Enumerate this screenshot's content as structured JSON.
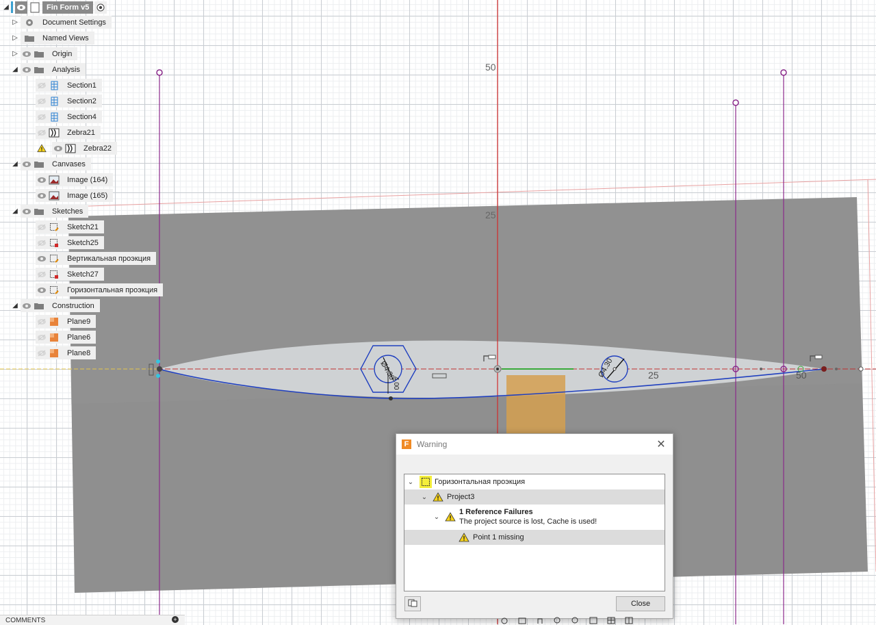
{
  "browser": {
    "root": "Fin  Form v5",
    "items": [
      {
        "label": "Document Settings"
      },
      {
        "label": "Named Views"
      },
      {
        "label": "Origin"
      },
      {
        "label": "Analysis"
      },
      {
        "label": "Section1"
      },
      {
        "label": "Section2"
      },
      {
        "label": "Section4"
      },
      {
        "label": "Zebra21"
      },
      {
        "label": "Zebra22"
      },
      {
        "label": "Canvases"
      },
      {
        "label": "Image (164)"
      },
      {
        "label": "Image (165)"
      },
      {
        "label": "Sketches"
      },
      {
        "label": "Sketch21"
      },
      {
        "label": "Sketch25"
      },
      {
        "label": "Вертикальная проэкция"
      },
      {
        "label": "Sketch27"
      },
      {
        "label": "Горизонтальная проэкция"
      },
      {
        "label": "Construction"
      },
      {
        "label": "Plane9"
      },
      {
        "label": "Plane6"
      },
      {
        "label": "Plane8"
      }
    ]
  },
  "canvas": {
    "dims": {
      "v50": "50",
      "v25": "25",
      "h25": "25",
      "h50": "50",
      "d1": "Ø4.30",
      "d2": "4.00",
      "d3": "Ø4.30"
    },
    "colors": {
      "sketch_line": "#1f3fbf",
      "axis_red": "#d22a2a",
      "constraint_purple": "#8b2a8b",
      "plate": "#8f8f8f",
      "fin": "#d6d9dc",
      "orange": "#f0b040",
      "green": "#3aaa3a"
    }
  },
  "dialog": {
    "title": "Warning",
    "tree": {
      "sketch": "Горизонтальная проэкция",
      "project": "Project3",
      "failure_title": "1 Reference Failures",
      "failure_desc": "The project source is lost, Cache is used!",
      "item": "Point 1 missing"
    },
    "close_label": "Close"
  },
  "comments": {
    "label": "COMMENTS"
  }
}
